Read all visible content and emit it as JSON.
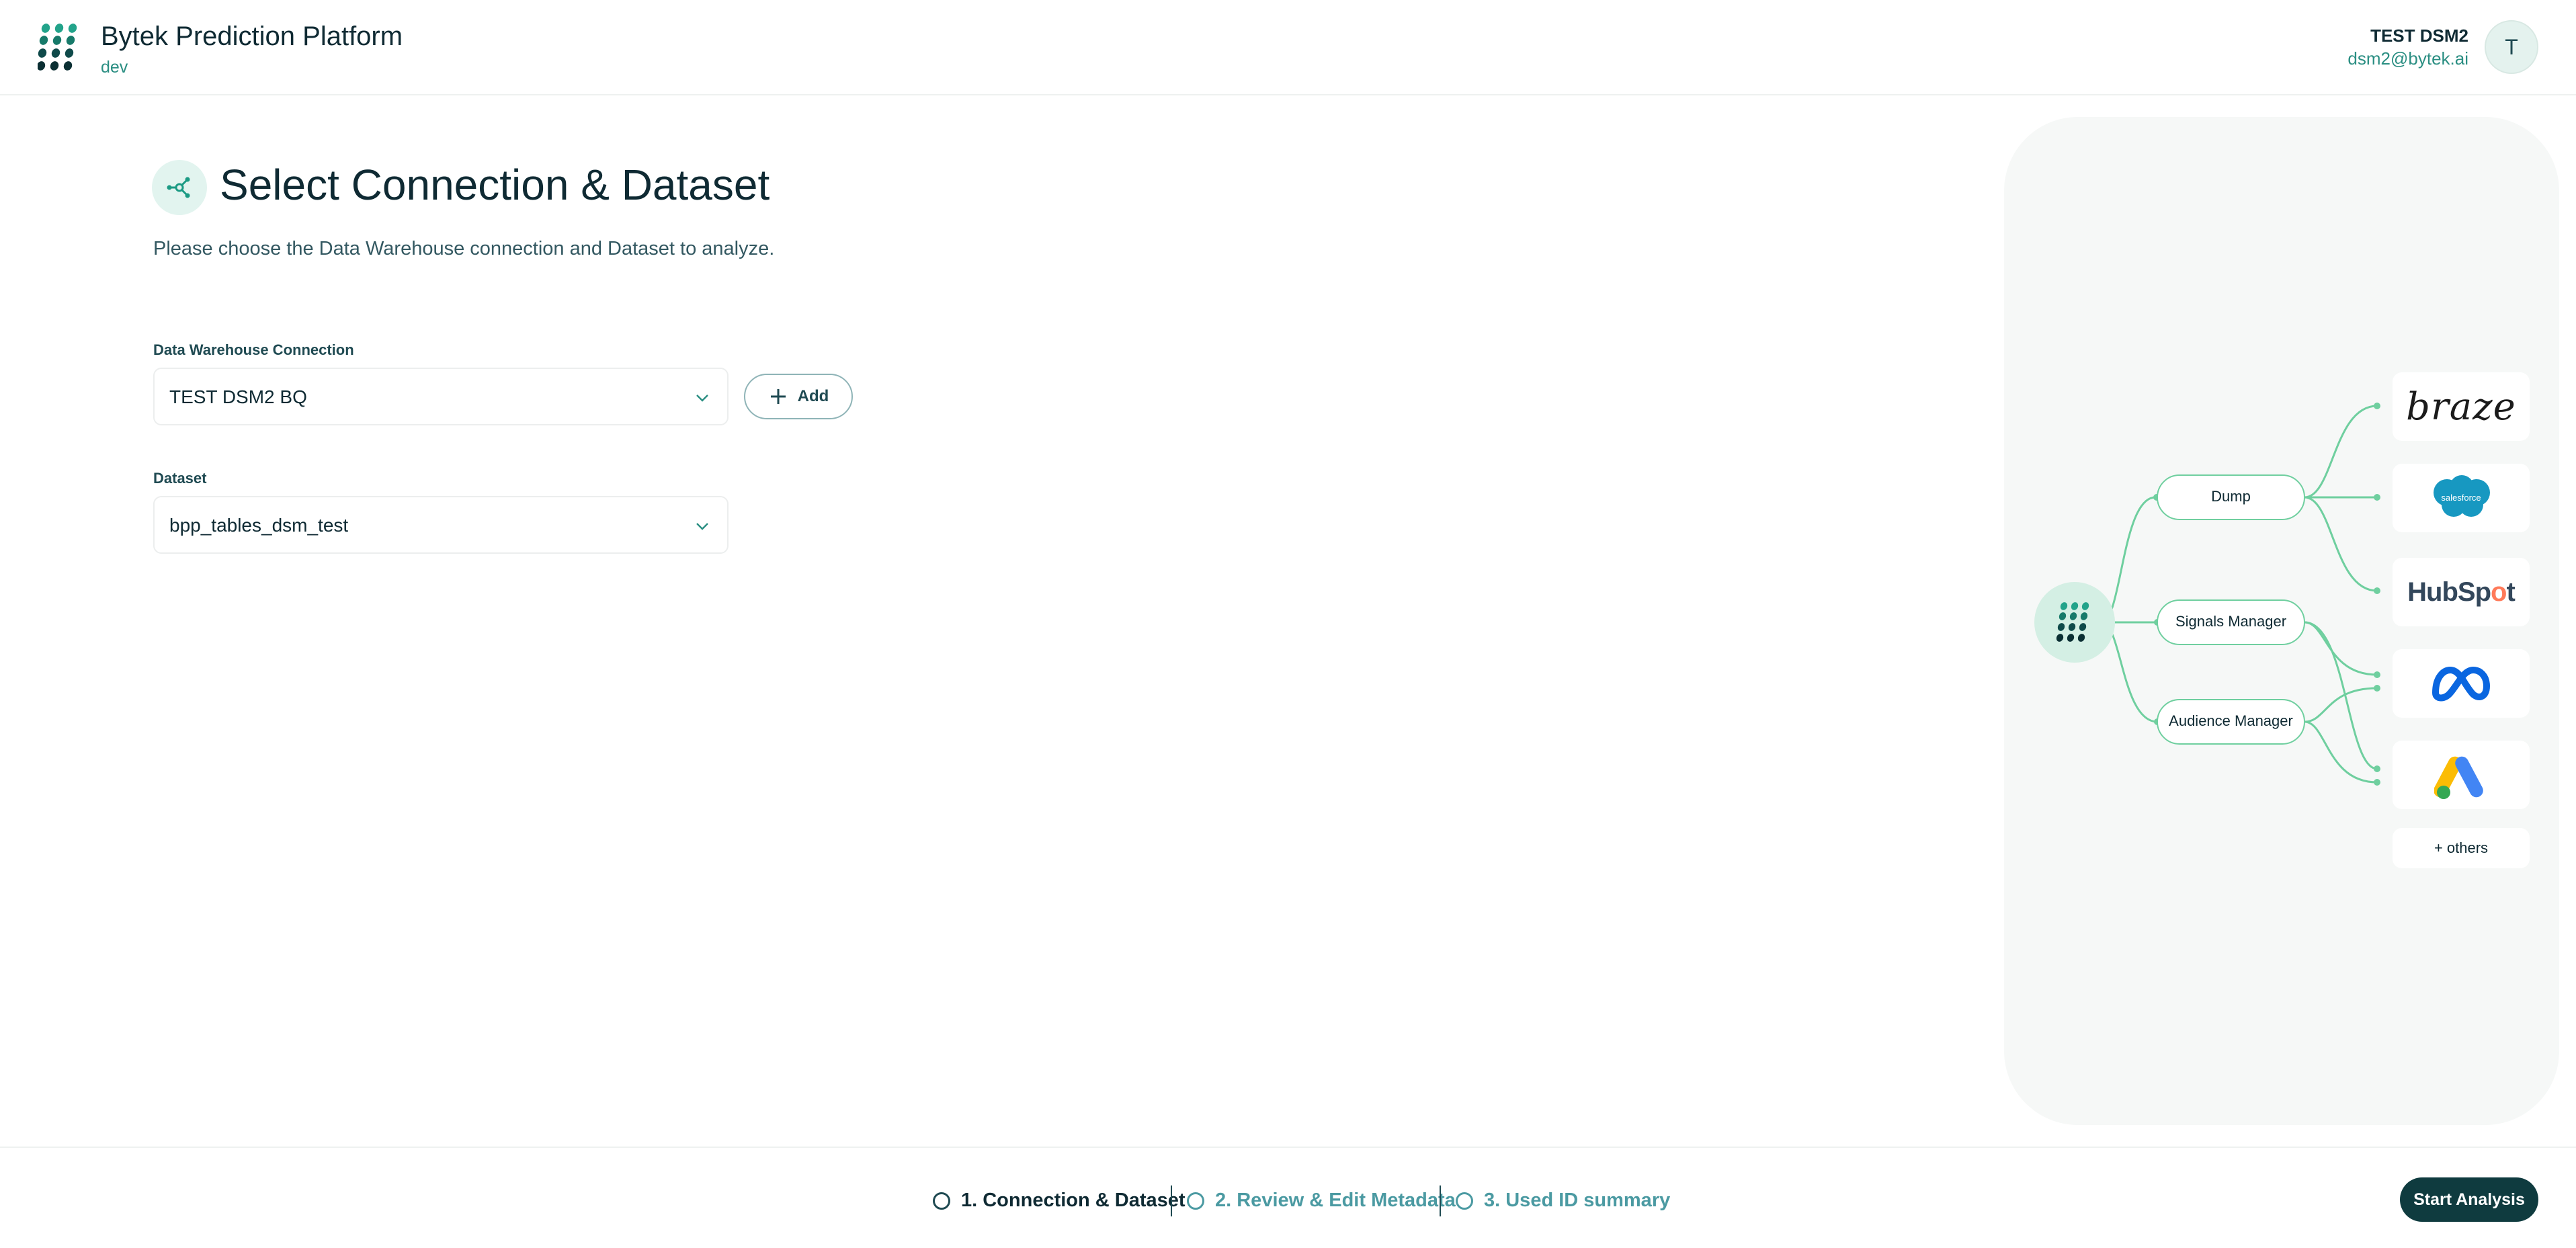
{
  "header": {
    "app_title": "Bytek Prediction Platform",
    "environment": "dev",
    "user_name": "TEST DSM2",
    "user_email": "dsm2@bytek.ai",
    "avatar_initial": "T"
  },
  "main": {
    "title": "Select Connection & Dataset",
    "subtitle": "Please choose the Data Warehouse connection and Dataset to analyze.",
    "connection": {
      "label": "Data Warehouse Connection",
      "value": "TEST DSM2 BQ",
      "add_label": "Add"
    },
    "dataset": {
      "label": "Dataset",
      "value": "bpp_tables_dsm_test"
    }
  },
  "illustration": {
    "nodes": [
      "Dump",
      "Signals Manager",
      "Audience Manager"
    ],
    "destinations": [
      "braze",
      "salesforce",
      "HubSpot",
      "Meta",
      "Google Ads"
    ],
    "braze_text": "braze",
    "salesforce_text": "salesforce",
    "hubspot_text_a": "HubSp",
    "hubspot_text_b": "o",
    "hubspot_text_c": "t",
    "others_label": "+ others"
  },
  "footer": {
    "steps": [
      {
        "label": "1. Connection & Dataset",
        "state": "active"
      },
      {
        "label": "2. Review & Edit Metadata",
        "state": "inactive"
      },
      {
        "label": "3. Used ID summary",
        "state": "inactive"
      }
    ],
    "start_button": "Start Analysis"
  },
  "colors": {
    "brand_dark": "#0f3b3f",
    "brand_accent": "#2a8e82",
    "connector": "#6fcf9f",
    "panel_background": "#f6f8f7"
  }
}
